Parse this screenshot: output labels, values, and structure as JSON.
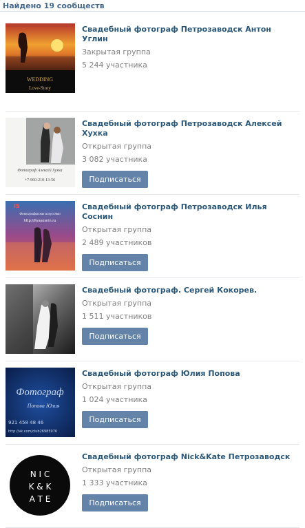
{
  "header": {
    "title": "Найдено 19 сообществ"
  },
  "communities": [
    {
      "name": "Свадебный фотограф Петрозаводск Антон Углин",
      "type": "Закрытая группа",
      "members": "5 244 участника",
      "subscribe_label": null,
      "avatar_text": {
        "line1": "WEDDING",
        "line2": "Love-Story"
      }
    },
    {
      "name": "Свадебный фотограф Петрозаводск Алексей Хухка",
      "type": "Открытая группа",
      "members": "3 082 участника",
      "subscribe_label": "Подписаться",
      "avatar_text": {
        "line1": "Фотограф Алексей Хухка",
        "line2": "+7-960-210-13-56"
      }
    },
    {
      "name": "Свадебный фотограф Петрозаводск Илья Соснин",
      "type": "Открытая группа",
      "members": "2 489 участников",
      "subscribe_label": "Подписаться",
      "avatar_text": {
        "line1": "Фотография как искусство",
        "line2": "http://ilyasosnin.ru"
      }
    },
    {
      "name": "Свадебный фотограф. Сергей Кокорев.",
      "type": "Открытая группа",
      "members": "1 511 участников",
      "subscribe_label": "Подписаться",
      "avatar_text": null
    },
    {
      "name": "Свадебный фотограф Юлия Попова",
      "type": "Открытая группа",
      "members": "1 024 участника",
      "subscribe_label": "Подписаться",
      "avatar_text": {
        "line1": "Фотограф",
        "line2": "Попова Юлия",
        "line3": "921 458 48 46",
        "line4": "http://vk.com/club26985976"
      }
    },
    {
      "name": "Свадебный фотограф Nick&Kate Петрозаводск",
      "type": "Открытая группа",
      "members": "1 333 участника",
      "subscribe_label": "Подписаться",
      "avatar_text": {
        "line1": "N I C",
        "line2": "K & K",
        "line3": "A T E"
      }
    }
  ],
  "colors": {
    "accent": "#45688e",
    "link": "#2b587a",
    "button": "#6383a8",
    "muted": "#808080"
  }
}
